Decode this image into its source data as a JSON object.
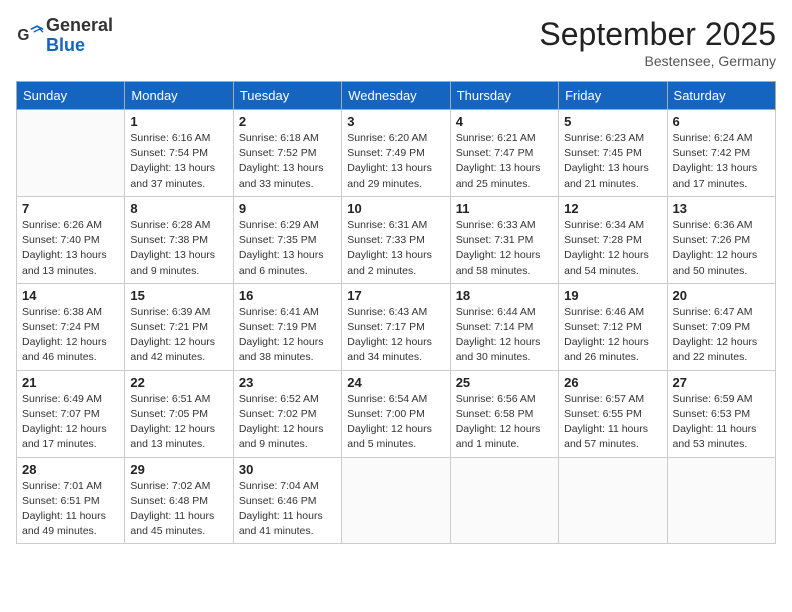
{
  "header": {
    "logo_general": "General",
    "logo_blue": "Blue",
    "month": "September 2025",
    "location": "Bestensee, Germany"
  },
  "days_of_week": [
    "Sunday",
    "Monday",
    "Tuesday",
    "Wednesday",
    "Thursday",
    "Friday",
    "Saturday"
  ],
  "weeks": [
    [
      {
        "day": "",
        "lines": []
      },
      {
        "day": "1",
        "lines": [
          "Sunrise: 6:16 AM",
          "Sunset: 7:54 PM",
          "Daylight: 13 hours",
          "and 37 minutes."
        ]
      },
      {
        "day": "2",
        "lines": [
          "Sunrise: 6:18 AM",
          "Sunset: 7:52 PM",
          "Daylight: 13 hours",
          "and 33 minutes."
        ]
      },
      {
        "day": "3",
        "lines": [
          "Sunrise: 6:20 AM",
          "Sunset: 7:49 PM",
          "Daylight: 13 hours",
          "and 29 minutes."
        ]
      },
      {
        "day": "4",
        "lines": [
          "Sunrise: 6:21 AM",
          "Sunset: 7:47 PM",
          "Daylight: 13 hours",
          "and 25 minutes."
        ]
      },
      {
        "day": "5",
        "lines": [
          "Sunrise: 6:23 AM",
          "Sunset: 7:45 PM",
          "Daylight: 13 hours",
          "and 21 minutes."
        ]
      },
      {
        "day": "6",
        "lines": [
          "Sunrise: 6:24 AM",
          "Sunset: 7:42 PM",
          "Daylight: 13 hours",
          "and 17 minutes."
        ]
      }
    ],
    [
      {
        "day": "7",
        "lines": [
          "Sunrise: 6:26 AM",
          "Sunset: 7:40 PM",
          "Daylight: 13 hours",
          "and 13 minutes."
        ]
      },
      {
        "day": "8",
        "lines": [
          "Sunrise: 6:28 AM",
          "Sunset: 7:38 PM",
          "Daylight: 13 hours",
          "and 9 minutes."
        ]
      },
      {
        "day": "9",
        "lines": [
          "Sunrise: 6:29 AM",
          "Sunset: 7:35 PM",
          "Daylight: 13 hours",
          "and 6 minutes."
        ]
      },
      {
        "day": "10",
        "lines": [
          "Sunrise: 6:31 AM",
          "Sunset: 7:33 PM",
          "Daylight: 13 hours",
          "and 2 minutes."
        ]
      },
      {
        "day": "11",
        "lines": [
          "Sunrise: 6:33 AM",
          "Sunset: 7:31 PM",
          "Daylight: 12 hours",
          "and 58 minutes."
        ]
      },
      {
        "day": "12",
        "lines": [
          "Sunrise: 6:34 AM",
          "Sunset: 7:28 PM",
          "Daylight: 12 hours",
          "and 54 minutes."
        ]
      },
      {
        "day": "13",
        "lines": [
          "Sunrise: 6:36 AM",
          "Sunset: 7:26 PM",
          "Daylight: 12 hours",
          "and 50 minutes."
        ]
      }
    ],
    [
      {
        "day": "14",
        "lines": [
          "Sunrise: 6:38 AM",
          "Sunset: 7:24 PM",
          "Daylight: 12 hours",
          "and 46 minutes."
        ]
      },
      {
        "day": "15",
        "lines": [
          "Sunrise: 6:39 AM",
          "Sunset: 7:21 PM",
          "Daylight: 12 hours",
          "and 42 minutes."
        ]
      },
      {
        "day": "16",
        "lines": [
          "Sunrise: 6:41 AM",
          "Sunset: 7:19 PM",
          "Daylight: 12 hours",
          "and 38 minutes."
        ]
      },
      {
        "day": "17",
        "lines": [
          "Sunrise: 6:43 AM",
          "Sunset: 7:17 PM",
          "Daylight: 12 hours",
          "and 34 minutes."
        ]
      },
      {
        "day": "18",
        "lines": [
          "Sunrise: 6:44 AM",
          "Sunset: 7:14 PM",
          "Daylight: 12 hours",
          "and 30 minutes."
        ]
      },
      {
        "day": "19",
        "lines": [
          "Sunrise: 6:46 AM",
          "Sunset: 7:12 PM",
          "Daylight: 12 hours",
          "and 26 minutes."
        ]
      },
      {
        "day": "20",
        "lines": [
          "Sunrise: 6:47 AM",
          "Sunset: 7:09 PM",
          "Daylight: 12 hours",
          "and 22 minutes."
        ]
      }
    ],
    [
      {
        "day": "21",
        "lines": [
          "Sunrise: 6:49 AM",
          "Sunset: 7:07 PM",
          "Daylight: 12 hours",
          "and 17 minutes."
        ]
      },
      {
        "day": "22",
        "lines": [
          "Sunrise: 6:51 AM",
          "Sunset: 7:05 PM",
          "Daylight: 12 hours",
          "and 13 minutes."
        ]
      },
      {
        "day": "23",
        "lines": [
          "Sunrise: 6:52 AM",
          "Sunset: 7:02 PM",
          "Daylight: 12 hours",
          "and 9 minutes."
        ]
      },
      {
        "day": "24",
        "lines": [
          "Sunrise: 6:54 AM",
          "Sunset: 7:00 PM",
          "Daylight: 12 hours",
          "and 5 minutes."
        ]
      },
      {
        "day": "25",
        "lines": [
          "Sunrise: 6:56 AM",
          "Sunset: 6:58 PM",
          "Daylight: 12 hours",
          "and 1 minute."
        ]
      },
      {
        "day": "26",
        "lines": [
          "Sunrise: 6:57 AM",
          "Sunset: 6:55 PM",
          "Daylight: 11 hours",
          "and 57 minutes."
        ]
      },
      {
        "day": "27",
        "lines": [
          "Sunrise: 6:59 AM",
          "Sunset: 6:53 PM",
          "Daylight: 11 hours",
          "and 53 minutes."
        ]
      }
    ],
    [
      {
        "day": "28",
        "lines": [
          "Sunrise: 7:01 AM",
          "Sunset: 6:51 PM",
          "Daylight: 11 hours",
          "and 49 minutes."
        ]
      },
      {
        "day": "29",
        "lines": [
          "Sunrise: 7:02 AM",
          "Sunset: 6:48 PM",
          "Daylight: 11 hours",
          "and 45 minutes."
        ]
      },
      {
        "day": "30",
        "lines": [
          "Sunrise: 7:04 AM",
          "Sunset: 6:46 PM",
          "Daylight: 11 hours",
          "and 41 minutes."
        ]
      },
      {
        "day": "",
        "lines": []
      },
      {
        "day": "",
        "lines": []
      },
      {
        "day": "",
        "lines": []
      },
      {
        "day": "",
        "lines": []
      }
    ]
  ]
}
